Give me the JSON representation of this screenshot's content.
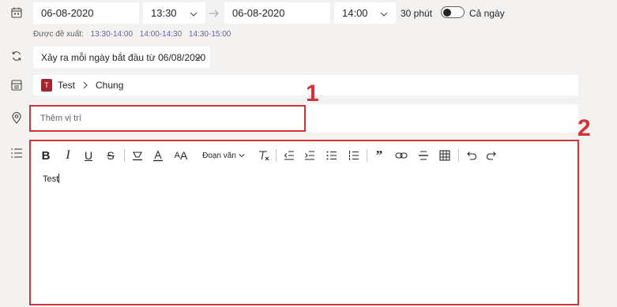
{
  "datetime": {
    "start_date": "06-08-2020",
    "start_time": "13:30",
    "end_date": "06-08-2020",
    "end_time": "14:00",
    "duration": "30 phút",
    "all_day_label": "Cả ngày",
    "all_day_on": false
  },
  "suggestions": {
    "label": "Được đề xuất:",
    "times": [
      "13:30-14:00",
      "14:00-14:30",
      "14:30-15:00"
    ]
  },
  "recurrence": {
    "value": "Xảy ra mỗi ngày bắt đầu từ 06/08/2020"
  },
  "channel": {
    "team_initial": "T",
    "team": "Test",
    "channel": "Chung",
    "team_color": "#a4262c"
  },
  "location": {
    "placeholder": "Thêm vị trí"
  },
  "editor": {
    "paragraph_style": "Đoạn văn",
    "body_text": "Test"
  },
  "annotations": {
    "label_1": "1",
    "label_2": "2",
    "color": "#d13438"
  },
  "colors": {
    "accent": "#6264a7",
    "background": "#f3f2f1"
  }
}
